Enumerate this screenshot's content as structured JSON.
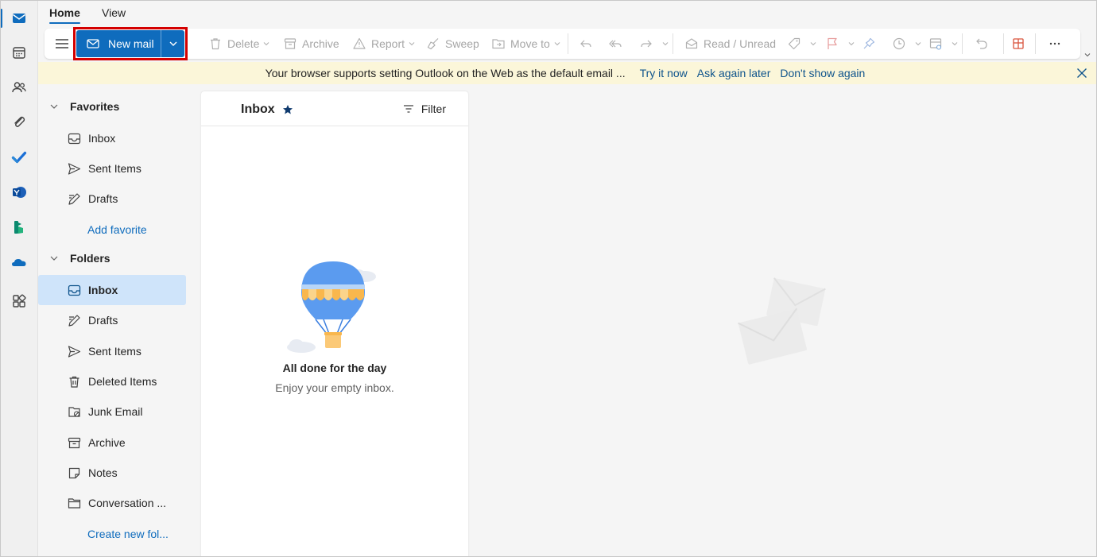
{
  "tabs": [
    {
      "label": "Home",
      "active": true
    },
    {
      "label": "View",
      "active": false
    }
  ],
  "ribbon": {
    "new_mail": "New mail",
    "delete": "Delete",
    "archive": "Archive",
    "report": "Report",
    "sweep": "Sweep",
    "move_to": "Move to",
    "read_unread": "Read / Unread"
  },
  "banner": {
    "message": "Your browser supports setting Outlook on the Web as the default email ...",
    "try_now": "Try it now",
    "ask_later": "Ask again later",
    "dont_show": "Don't show again"
  },
  "folder_pane": {
    "favorites_header": "Favorites",
    "favorites": [
      "Inbox",
      "Sent Items",
      "Drafts"
    ],
    "add_favorite": "Add favorite",
    "folders_header": "Folders",
    "folders": [
      "Inbox",
      "Drafts",
      "Sent Items",
      "Deleted Items",
      "Junk Email",
      "Archive",
      "Notes",
      "Conversation ..."
    ],
    "create_folder": "Create new fol..."
  },
  "message_list": {
    "title": "Inbox",
    "filter": "Filter",
    "empty_title": "All done for the day",
    "empty_subtitle": "Enjoy your empty inbox."
  },
  "rail_apps": [
    "mail-icon",
    "calendar-icon",
    "people-icon",
    "attachment-icon",
    "todo-icon",
    "yammer-icon",
    "bookings-icon",
    "onedrive-icon",
    "more-apps-icon"
  ],
  "colors": {
    "accent": "#0f6cbd",
    "selected_folder": "#cfe4fa",
    "banner_bg": "#fbf6d9",
    "highlight_outline": "#d40000"
  }
}
